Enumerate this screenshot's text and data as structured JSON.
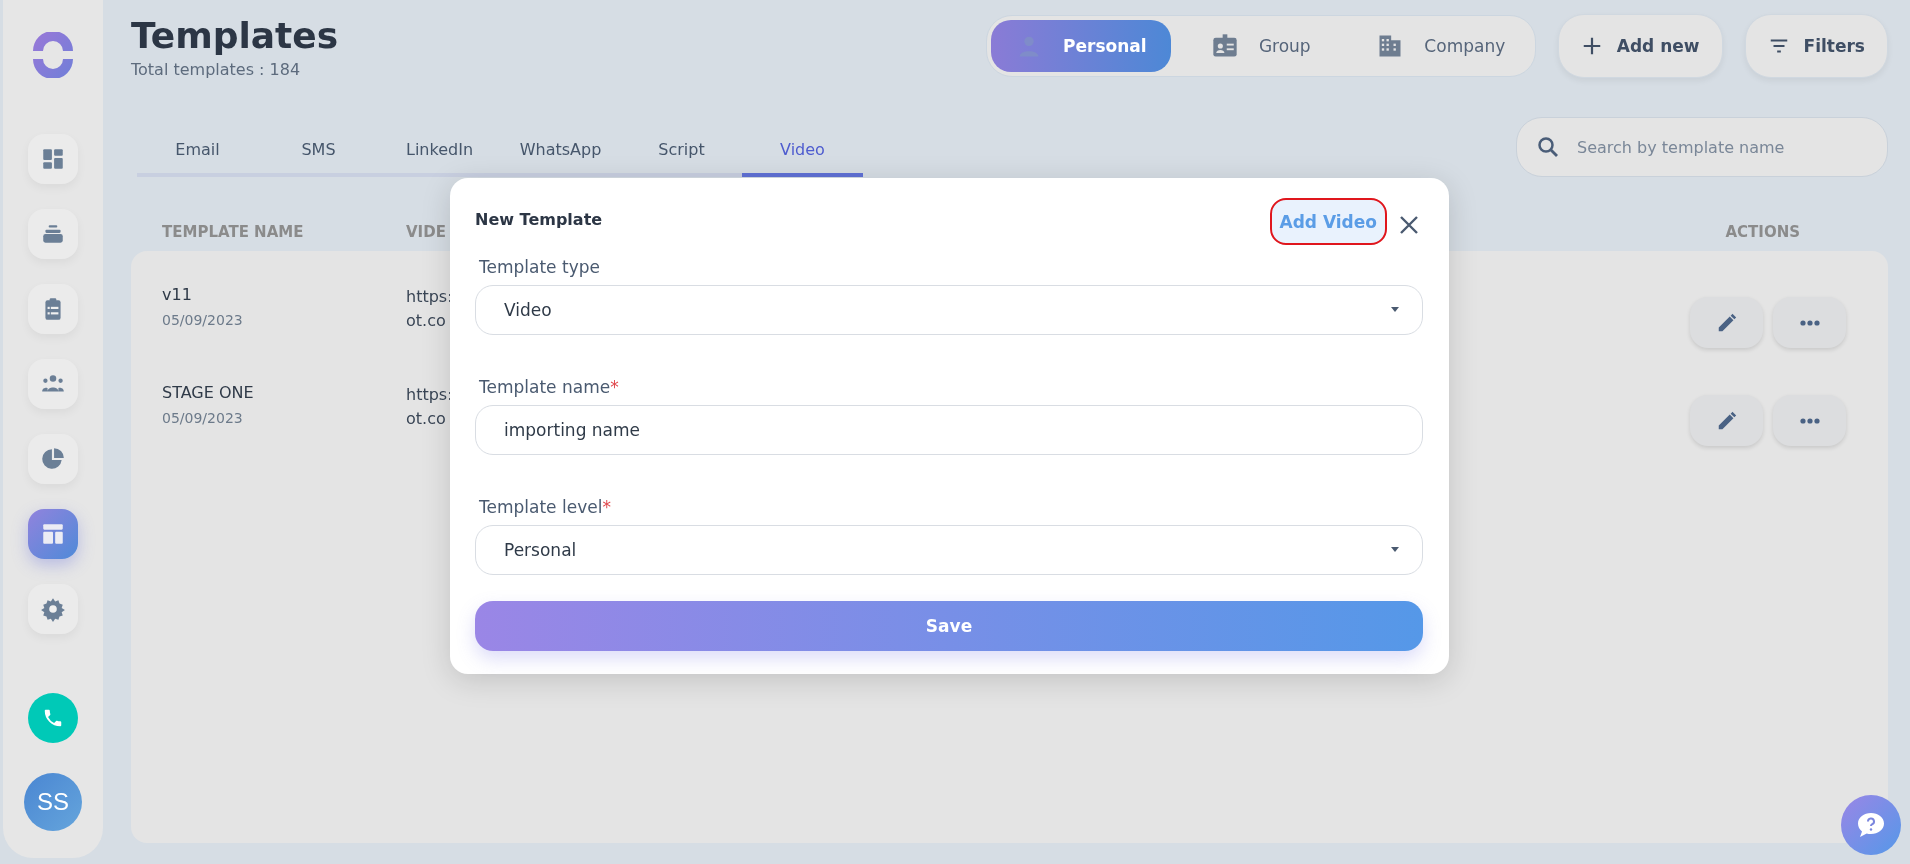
{
  "sidebar": {
    "items": [
      {
        "kind": "dashboard",
        "selected": false
      },
      {
        "kind": "stack",
        "selected": false
      },
      {
        "kind": "clipboard",
        "selected": false
      },
      {
        "kind": "people",
        "selected": false
      },
      {
        "kind": "pie",
        "selected": false
      },
      {
        "kind": "layout",
        "selected": true
      },
      {
        "kind": "gear",
        "selected": false
      }
    ],
    "avatar": "SS"
  },
  "header": {
    "title": "Templates",
    "subtitle": "Total templates : 184"
  },
  "levels": [
    {
      "label": "Personal",
      "kind": "person",
      "selected": true
    },
    {
      "label": "Group",
      "kind": "badge",
      "selected": false
    },
    {
      "label": "Company",
      "kind": "building",
      "selected": false
    }
  ],
  "add_button": "Add new",
  "filters_button": "Filters",
  "tabs": [
    {
      "label": "Email",
      "selected": false
    },
    {
      "label": "SMS",
      "selected": false
    },
    {
      "label": "LinkedIn",
      "selected": false
    },
    {
      "label": "WhatsApp",
      "selected": false
    },
    {
      "label": "Script",
      "selected": false
    },
    {
      "label": "Video",
      "selected": true
    }
  ],
  "search": {
    "placeholder": "Search by template name"
  },
  "table": {
    "columns": [
      "TEMPLATE NAME",
      "VIDE",
      "ACTIONS"
    ],
    "rows": [
      {
        "name": "v11",
        "date": "05/09/2023",
        "url": [
          "https:",
          "ot.co"
        ]
      },
      {
        "name": "STAGE ONE",
        "date": "05/09/2023",
        "url": [
          "https:",
          "ot.co"
        ]
      }
    ]
  },
  "modal": {
    "title": "New Template",
    "add_video": "Add Video",
    "fields": [
      {
        "kind": "select",
        "label": "Template type",
        "value": "Video"
      },
      {
        "kind": "text",
        "label": "Template name",
        "required_mark": "*",
        "value": "importing name"
      },
      {
        "kind": "select",
        "label": "Template level",
        "required_mark": "*",
        "value": "Personal"
      }
    ],
    "save": "Save"
  }
}
